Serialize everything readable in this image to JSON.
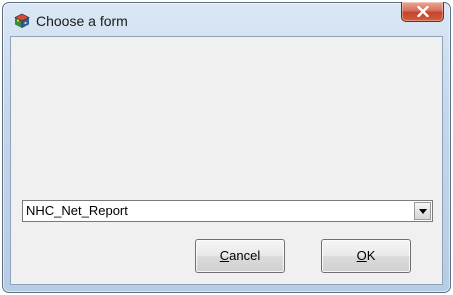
{
  "window": {
    "title": "Choose a form",
    "app_icon": "cube-icon",
    "close_icon": "close-icon",
    "accent_color": "#c4442c"
  },
  "form_select": {
    "selected_value": "NHC_Net_Report",
    "dropdown_icon": "chevron-down-icon"
  },
  "buttons": {
    "cancel_mnemonic": "C",
    "cancel_rest": "ancel",
    "ok_mnemonic": "O",
    "ok_rest": "K"
  }
}
